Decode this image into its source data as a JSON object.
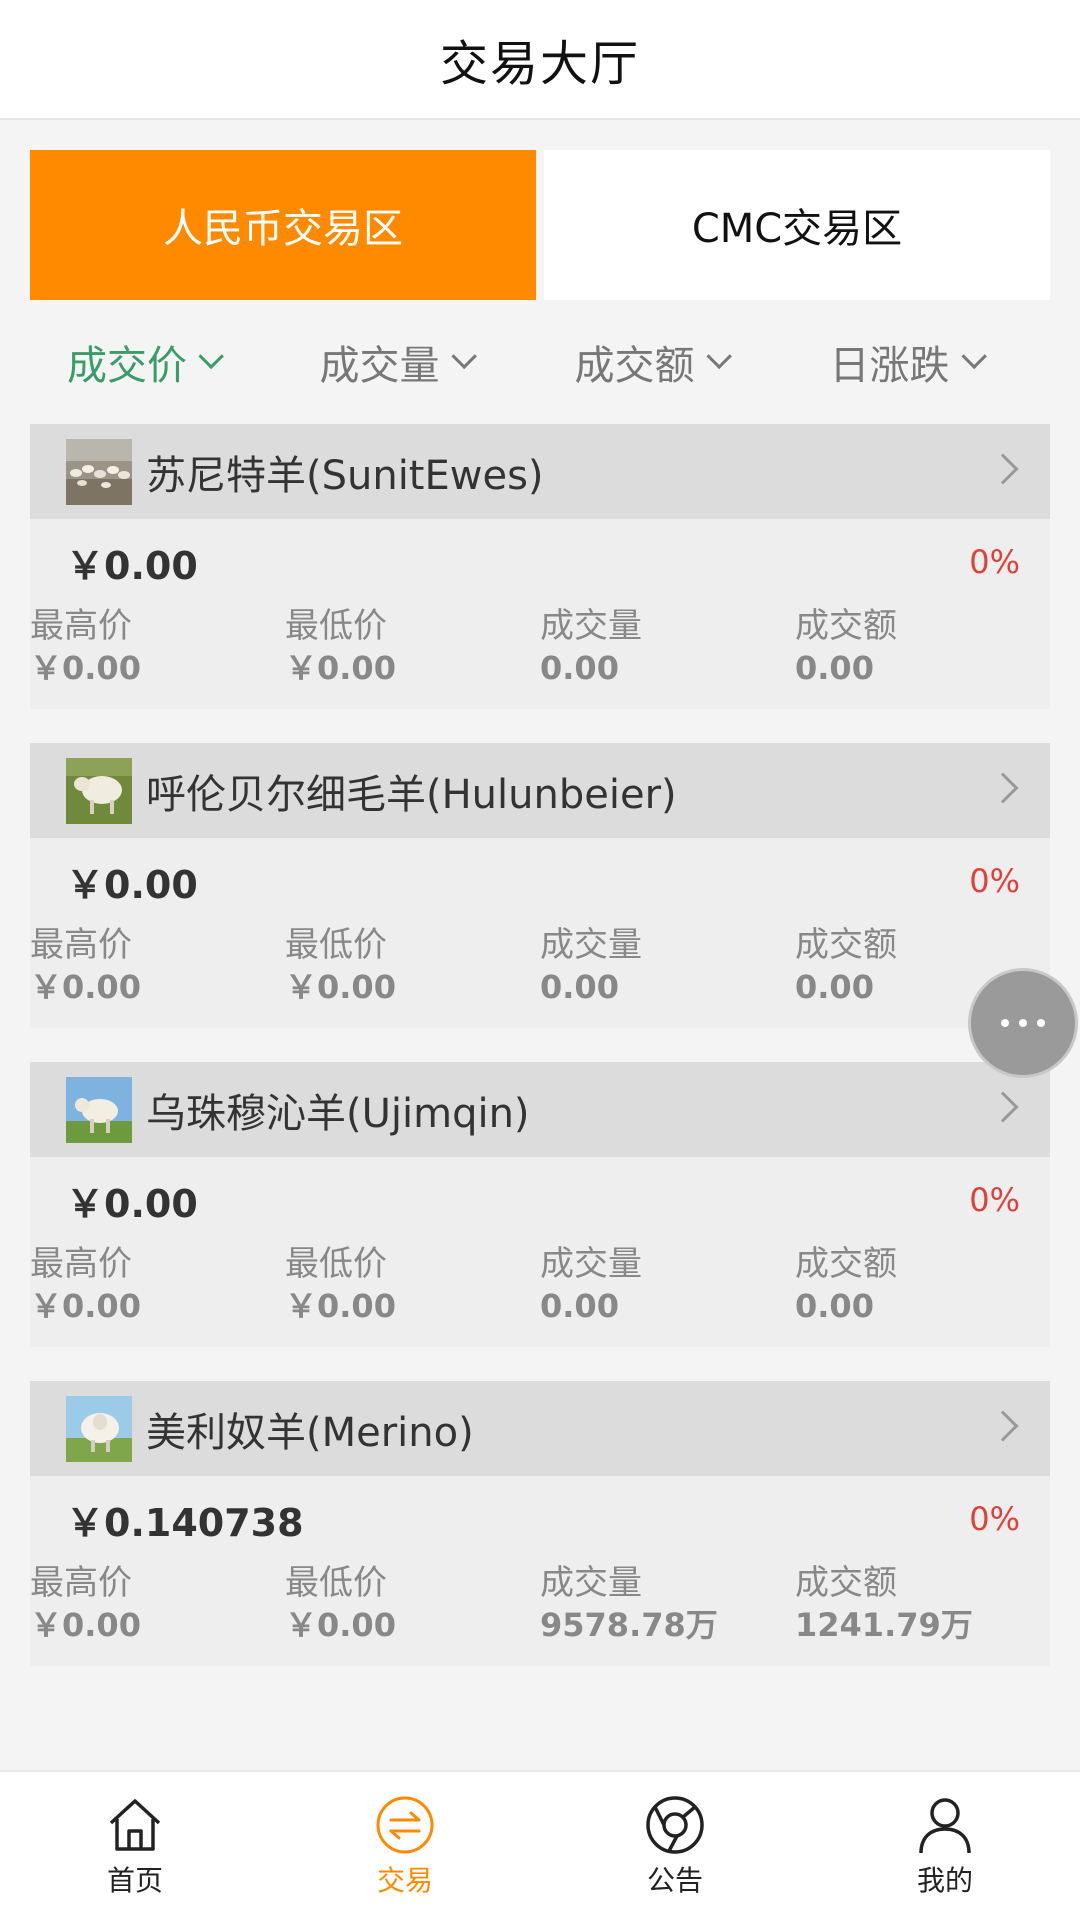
{
  "header": {
    "title": "交易大厅"
  },
  "zone_tabs": [
    {
      "label": "人民币交易区",
      "active": true
    },
    {
      "label": "CMC交易区",
      "active": false
    }
  ],
  "sort": [
    {
      "label": "成交价",
      "active": true
    },
    {
      "label": "成交量",
      "active": false
    },
    {
      "label": "成交额",
      "active": false
    },
    {
      "label": "日涨跌",
      "active": false
    }
  ],
  "stat_labels": {
    "high": "最高价",
    "low": "最低价",
    "volume": "成交量",
    "amount": "成交额"
  },
  "items": [
    {
      "name": "苏尼特羊(SunitEwes)",
      "price": "￥0.00",
      "change": "0%",
      "high": "￥0.00",
      "low": "￥0.00",
      "volume": "0.00",
      "amount": "0.00"
    },
    {
      "name": "呼伦贝尔细毛羊(Hulunbeier)",
      "price": "￥0.00",
      "change": "0%",
      "high": "￥0.00",
      "low": "￥0.00",
      "volume": "0.00",
      "amount": "0.00"
    },
    {
      "name": "乌珠穆沁羊(Ujimqin)",
      "price": "￥0.00",
      "change": "0%",
      "high": "￥0.00",
      "low": "￥0.00",
      "volume": "0.00",
      "amount": "0.00"
    },
    {
      "name": "美利奴羊(Merino)",
      "price": "￥0.140738",
      "change": "0%",
      "high": "￥0.00",
      "low": "￥0.00",
      "volume": "9578.78万",
      "amount": "1241.79万"
    }
  ],
  "nav": [
    {
      "label": "首页",
      "icon": "home-icon",
      "active": false
    },
    {
      "label": "交易",
      "icon": "exchange-icon",
      "active": true
    },
    {
      "label": "公告",
      "icon": "announcement-icon",
      "active": false
    },
    {
      "label": "我的",
      "icon": "user-icon",
      "active": false
    }
  ],
  "colors": {
    "accent": "#ff8a00",
    "sort_active": "#3a9c68",
    "change": "#e0403a"
  }
}
